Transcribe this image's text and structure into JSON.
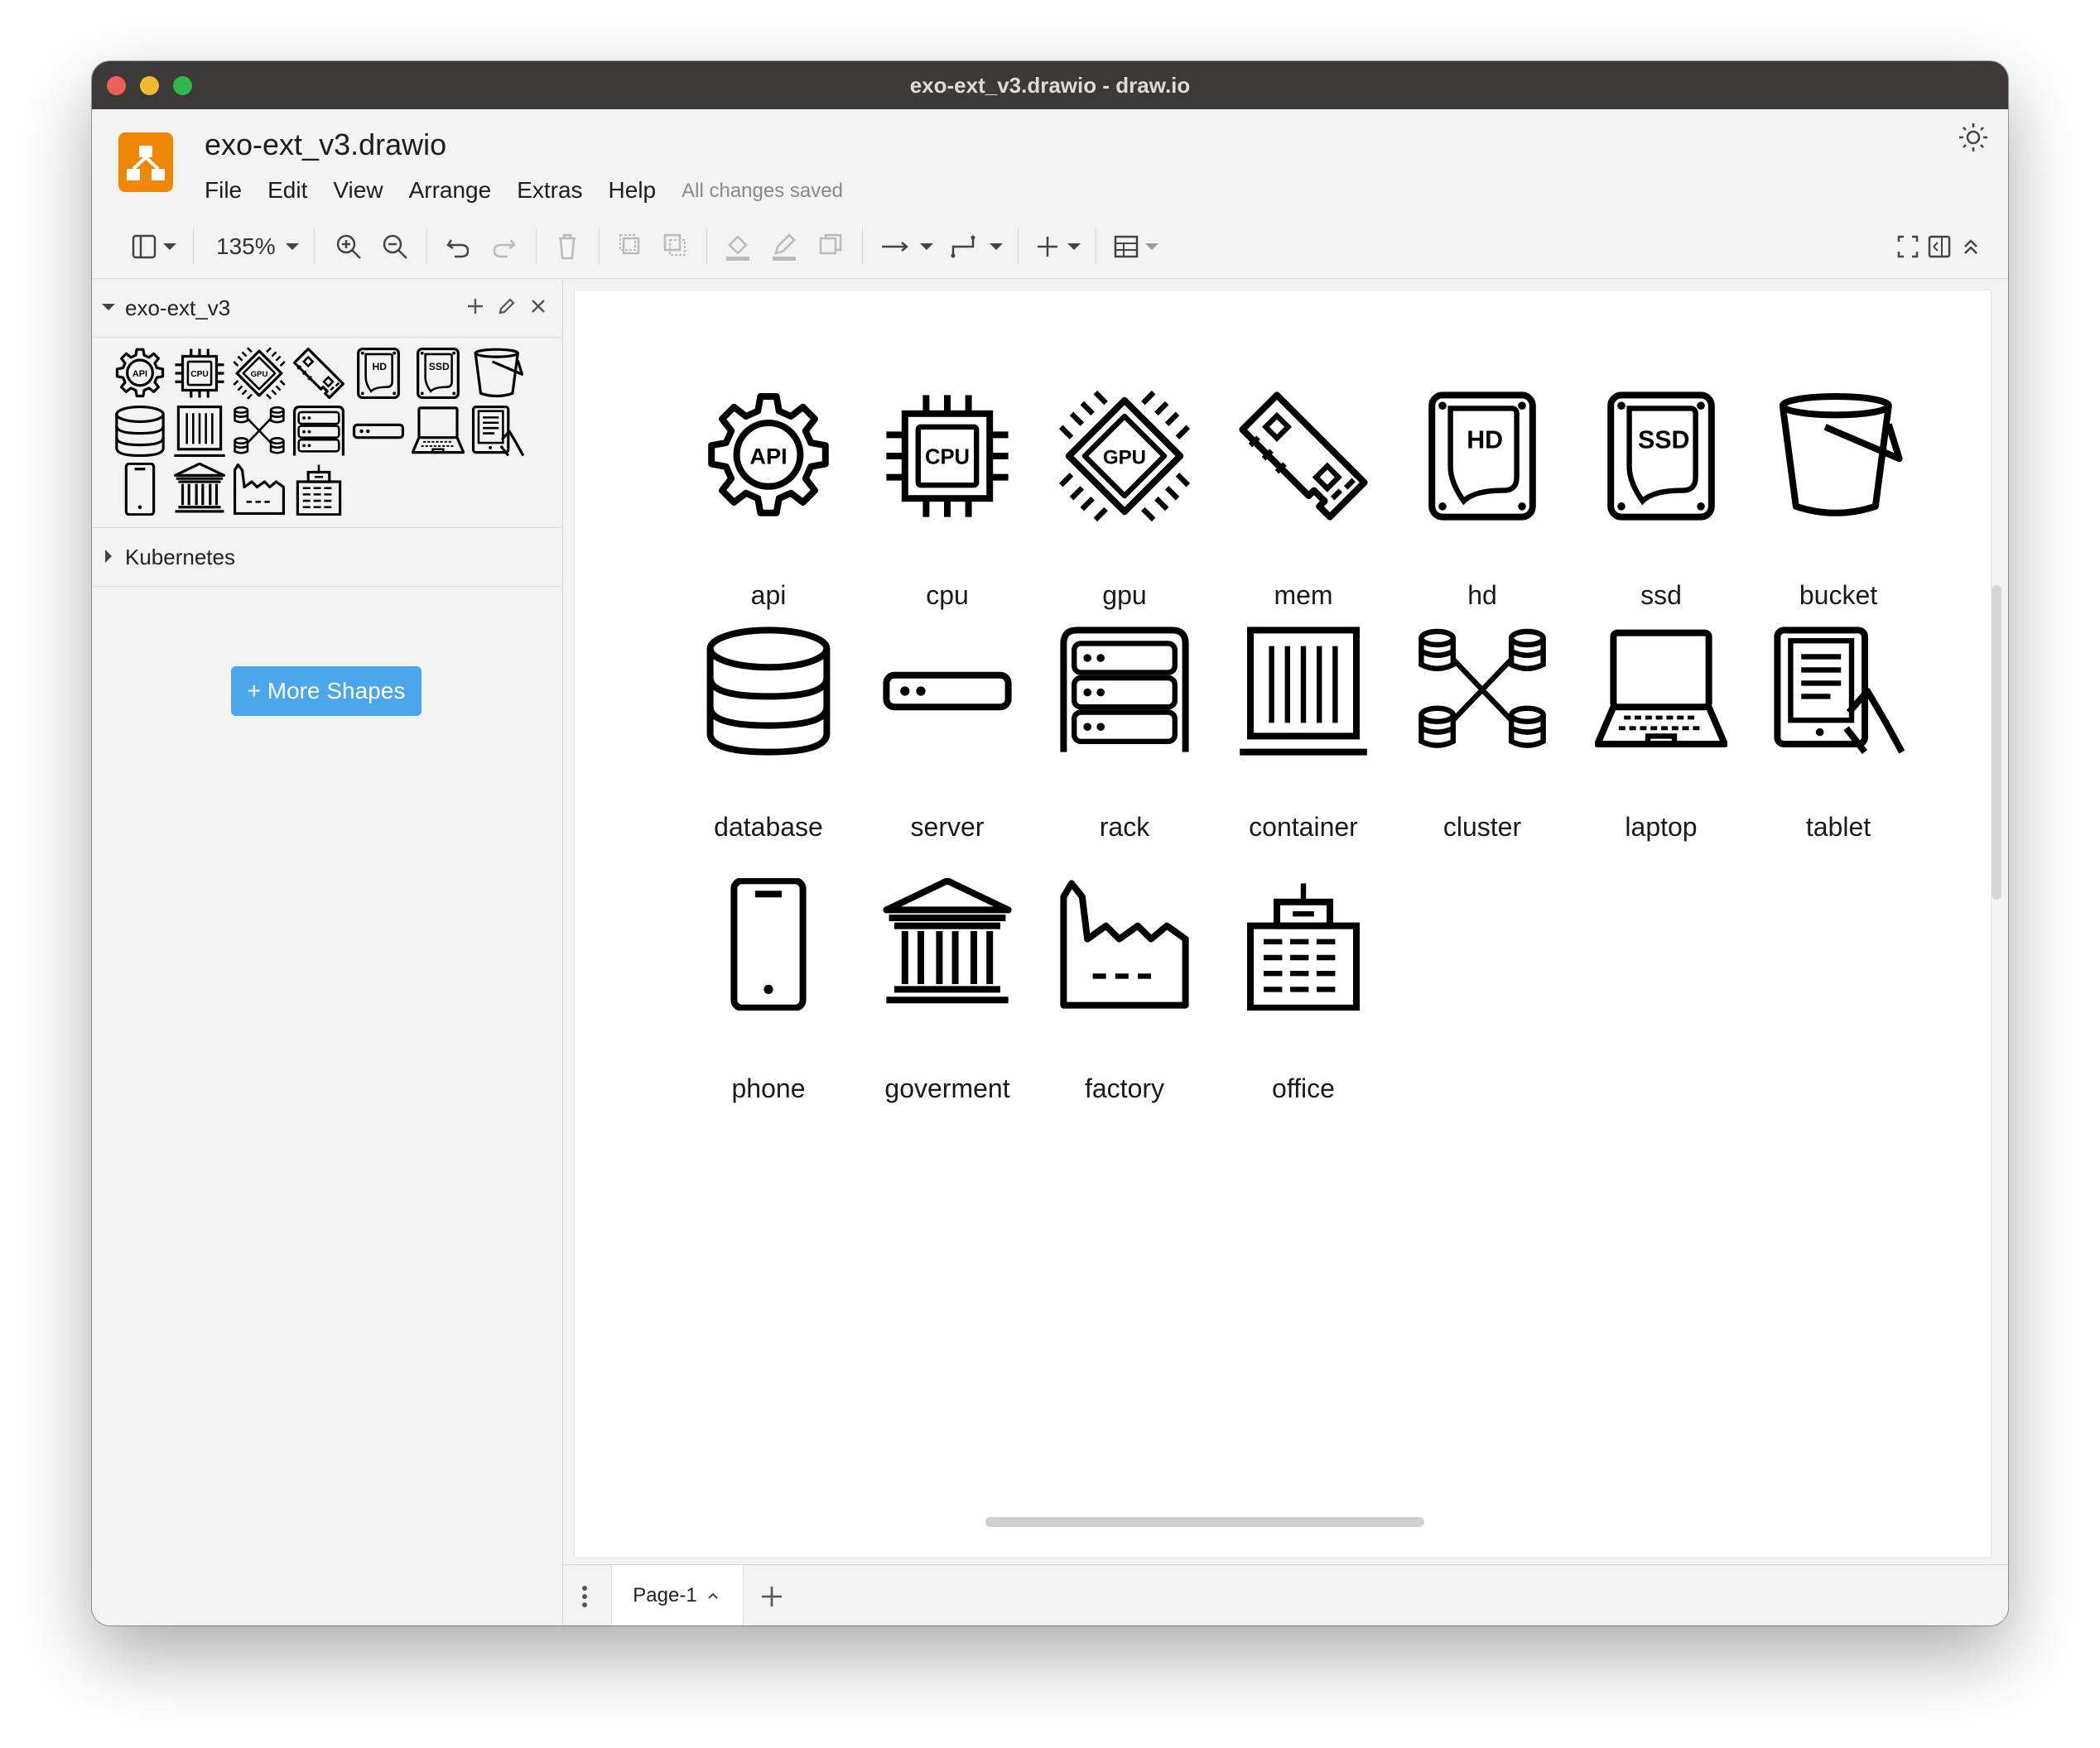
{
  "window": {
    "title": "exo-ext_v3.drawio - draw.io"
  },
  "header": {
    "file_name": "exo-ext_v3.drawio",
    "menu": [
      "File",
      "Edit",
      "View",
      "Arrange",
      "Extras",
      "Help"
    ],
    "status": "All changes saved"
  },
  "toolbar": {
    "zoom": "135%"
  },
  "sidebar": {
    "library_name": "exo-ext_v3",
    "section": "Kubernetes",
    "more_shapes": "+ More Shapes"
  },
  "canvas": {
    "shapes": [
      {
        "label": "api",
        "icon": "api-icon"
      },
      {
        "label": "cpu",
        "icon": "cpu-icon"
      },
      {
        "label": "gpu",
        "icon": "gpu-icon"
      },
      {
        "label": "mem",
        "icon": "memory-icon"
      },
      {
        "label": "hd",
        "icon": "hard-disk-icon"
      },
      {
        "label": "ssd",
        "icon": "ssd-icon"
      },
      {
        "label": "bucket",
        "icon": "bucket-icon"
      },
      {
        "label": "database",
        "icon": "database-icon"
      },
      {
        "label": "server",
        "icon": "server-icon"
      },
      {
        "label": "rack",
        "icon": "rack-icon"
      },
      {
        "label": "container",
        "icon": "container-icon"
      },
      {
        "label": "cluster",
        "icon": "cluster-icon"
      },
      {
        "label": "laptop",
        "icon": "laptop-icon"
      },
      {
        "label": "tablet",
        "icon": "tablet-icon"
      },
      {
        "label": "phone",
        "icon": "phone-icon"
      },
      {
        "label": "goverment",
        "icon": "government-icon"
      },
      {
        "label": "factory",
        "icon": "factory-icon"
      },
      {
        "label": "office",
        "icon": "office-icon"
      }
    ]
  },
  "footer": {
    "page_tab": "Page-1"
  }
}
